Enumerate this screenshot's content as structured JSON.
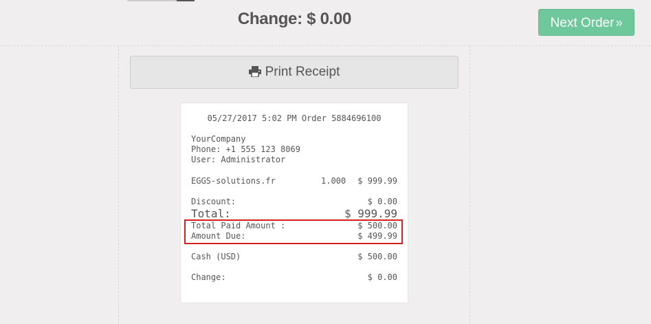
{
  "header": {
    "change_label": "Change: $ 0.00",
    "next_order_label": "Next Order",
    "next_order_icon": "double-chevron-right-icon"
  },
  "actions": {
    "print_label": "Print Receipt",
    "print_icon": "printer-icon"
  },
  "receipt": {
    "header_line": "05/27/2017 5:02 PM Order 5884696100",
    "company": "YourCompany",
    "phone": "Phone: +1 555 123 8069",
    "user": "User: Administrator",
    "items": [
      {
        "name": "EGGS-solutions.fr",
        "qty": "1.000",
        "price": "$ 999.99"
      }
    ],
    "discount_label": "Discount:",
    "discount_value": "$ 0.00",
    "total_label": "Total:",
    "total_value": "$ 999.99",
    "paid_label": "Total Paid Amount :",
    "paid_value": "$ 500.00",
    "due_label": "Amount Due:",
    "due_value": "$ 499.99",
    "payment_label": "Cash (USD)",
    "payment_value": "$ 500.00",
    "change_label": "Change:",
    "change_value": "$ 0.00"
  },
  "colors": {
    "accent_green": "#6ec89b",
    "highlight_red": "#d42020"
  }
}
